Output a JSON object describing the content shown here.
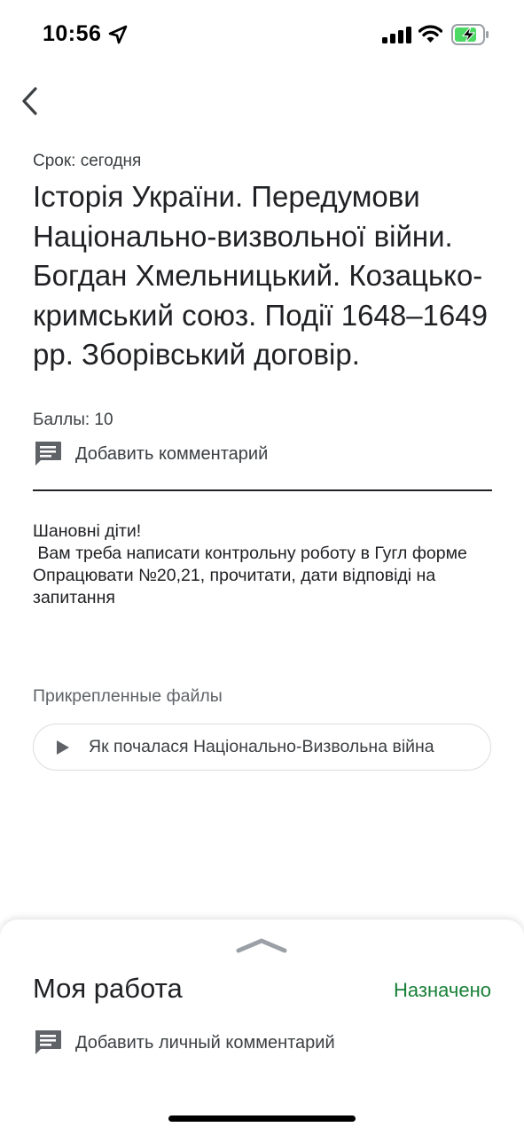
{
  "status_bar": {
    "time": "10:56",
    "icons": [
      "location-arrow-icon",
      "cellular-signal-icon",
      "wifi-icon",
      "battery-charging-icon"
    ],
    "battery_color": "#4cd964"
  },
  "nav": {
    "back_icon": "chevron-left-icon"
  },
  "assignment": {
    "due": "Срок: сегодня",
    "title": "Історія України. Передумови Національно-визвольної війни. Богдан Хмельницький. Козацько-кримський союз. Події 1648–1649 рр. Зборівський договір.",
    "points": "Баллы: 10",
    "add_comment_label": "Добавить комментарий",
    "comment_icon": "comment-icon",
    "instructions": "Шановні діти!\n Вам треба написати контрольну роботу в Гугл формe\nОпрацювати №20,21, прочитати, дати відповіді на запитання"
  },
  "attachments": {
    "label": "Прикрепленные файлы",
    "items": [
      {
        "title": "Як почалася Національно-Визвольна війна",
        "icon": "play-icon"
      }
    ]
  },
  "my_work": {
    "title": "Моя работа",
    "status": "Назначено",
    "status_color": "#188038",
    "add_private_comment_label": "Добавить личный комментарий",
    "handle_icon": "chevron-up-icon"
  }
}
